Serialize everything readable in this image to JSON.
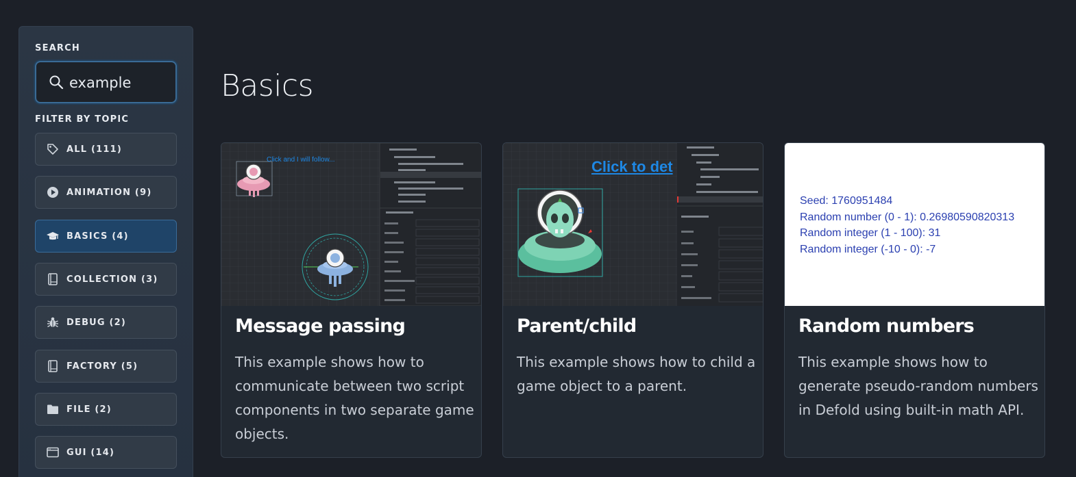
{
  "sidebar": {
    "search_heading": "SEARCH",
    "search_value": "example",
    "filter_heading": "FILTER BY TOPIC",
    "topics": [
      {
        "label": "ALL (111)",
        "icon": "tag-icon",
        "active": false
      },
      {
        "label": "ANIMATION (9)",
        "icon": "play-circle-icon",
        "active": false
      },
      {
        "label": "BASICS (4)",
        "icon": "graduation-cap-icon",
        "active": true
      },
      {
        "label": "COLLECTION (3)",
        "icon": "book-icon",
        "active": false
      },
      {
        "label": "DEBUG (2)",
        "icon": "bug-icon",
        "active": false
      },
      {
        "label": "FACTORY (5)",
        "icon": "book-icon",
        "active": false
      },
      {
        "label": "FILE (2)",
        "icon": "folder-icon",
        "active": false
      },
      {
        "label": "GUI (14)",
        "icon": "window-icon",
        "active": false
      }
    ]
  },
  "main": {
    "title": "Basics",
    "cards": [
      {
        "title": "Message passing",
        "description": "This example shows how to communicate between two script components in two separate game objects.",
        "thumb_caption": "Click and I will follow..."
      },
      {
        "title": "Parent/child",
        "description": "This example shows how to child a game object to a parent.",
        "thumb_caption": "Click to det"
      },
      {
        "title": "Random numbers",
        "description": "This example shows how to generate pseudo-random numbers in Defold using built-in math API.",
        "thumb_lines": [
          "Seed: 1760951484",
          "Random number (0 - 1): 0.26980590820313",
          "Random integer (1 - 100): 31",
          "Random integer (-10 - 0): -7"
        ]
      }
    ]
  },
  "colors": {
    "background": "#1c2028",
    "accent": "#1f4468",
    "card": "#222932",
    "link_blue": "#1e88e5"
  }
}
